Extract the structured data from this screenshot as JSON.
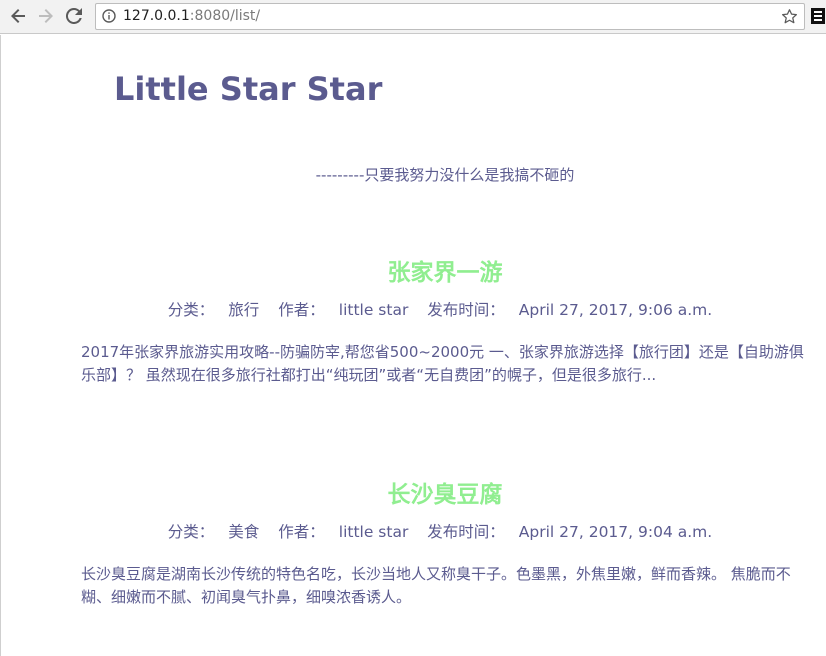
{
  "browser": {
    "url_host": "127.0.0.1",
    "url_rest": ":8080/list/"
  },
  "site": {
    "title": "Little Star Star",
    "motto": "---------只要我努力没什么是我搞不砸的"
  },
  "meta_labels": {
    "category": "分类：",
    "author": "作者：",
    "published": "发布时间："
  },
  "posts": [
    {
      "title": "张家界一游",
      "category": "旅行",
      "author": "little star",
      "published": "April 27, 2017, 9:06 a.m.",
      "excerpt": "2017年张家界旅游实用攻略--防骗防宰,帮您省500~2000元 一、张家界旅游选择【旅行团】还是【自助游俱乐部】？ 虽然现在很多旅行社都打出“纯玩团”或者“无自费团”的幌子，但是很多旅行..."
    },
    {
      "title": "长沙臭豆腐",
      "category": "美食",
      "author": "little star",
      "published": "April 27, 2017, 9:04 a.m.",
      "excerpt": "长沙臭豆腐是湖南长沙传统的特色名吃，长沙当地人又称臭干子。色墨黑，外焦里嫩，鲜而香辣。 焦脆而不糊、细嫩而不腻、初闻臭气扑鼻，细嗅浓香诱人。"
    }
  ],
  "colors": {
    "text": "#5b5b8f",
    "post_title": "#90ee90"
  },
  "icons": [
    "back-arrow-icon",
    "forward-arrow-icon",
    "reload-icon",
    "info-icon",
    "star-icon",
    "extension-icon"
  ]
}
